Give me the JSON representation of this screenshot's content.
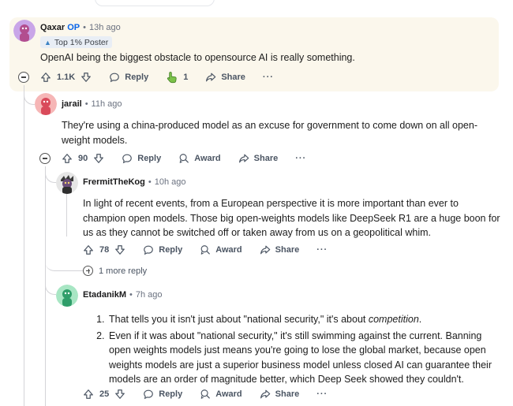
{
  "comments": [
    {
      "username": "Qaxar",
      "op_badge": "OP",
      "time": "13h ago",
      "flair": "Top 1% Poster",
      "text": "OpenAI being the biggest obstacle to opensource AI is really something.",
      "votes": "1.1K",
      "reply_label": "Reply",
      "award_count": "1",
      "share_label": "Share",
      "more_label": "···"
    },
    {
      "username": "jarail",
      "time": "11h ago",
      "text_line1": "They're using a china-produced model as an excuse for government to come down on all open-",
      "text_line2": "weight models.",
      "votes": "90",
      "reply_label": "Reply",
      "award_label": "Award",
      "share_label": "Share",
      "more_label": "···"
    },
    {
      "username": "FrermitTheKog",
      "time": "10h ago",
      "text_line1": "In light of recent events, from a European perspective it is more important than ever to",
      "text_line2": "champion open models. Those big open-weights models like DeepSeek R1 are a huge boon for",
      "text_line3": "us as they cannot be switched off or taken away from us on a geopolitical whim.",
      "votes": "78",
      "reply_label": "Reply",
      "award_label": "Award",
      "share_label": "Share",
      "more_label": "···",
      "more_replies": "1 more reply"
    },
    {
      "username": "EtadanikM",
      "time": "7h ago",
      "item1_prefix": "That tells you it isn't just about \"national security,\" it's about ",
      "item1_emph": "competition",
      "item1_suffix": ".",
      "item2_line1": "Even if it was about \"national security,\" it's still swimming against the current. Banning",
      "item2_line2": "open weights models just means you're going to lose the global market, because open",
      "item2_line3": "weights models are just a superior business model unless closed AI can guarantee their",
      "item2_line4": "models are an order of magnitude better, which Deep Seek showed they couldn't.",
      "votes": "25",
      "reply_label": "Reply",
      "award_label": "Award",
      "share_label": "Share",
      "more_label": "···"
    }
  ],
  "separator": "•",
  "colors": {
    "op_blue": "#0a65e8",
    "highlight_bg": "#fbf7ec",
    "thread_line": "#d4d4d8"
  }
}
